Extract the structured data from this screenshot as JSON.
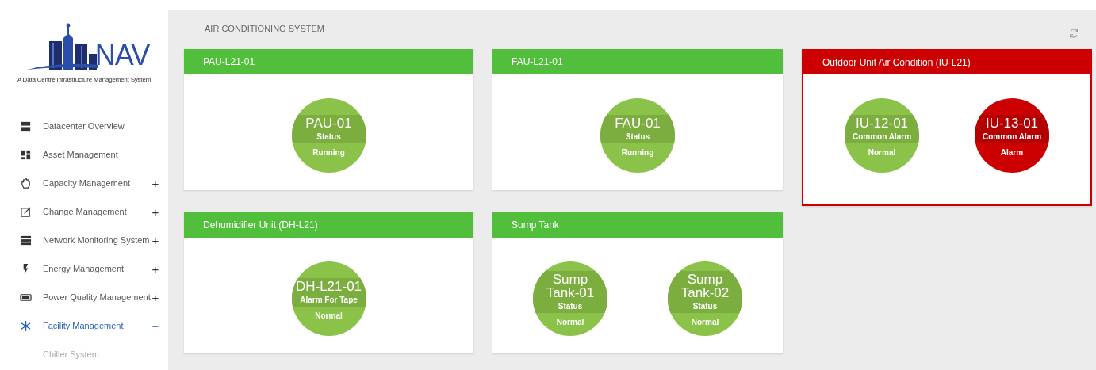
{
  "logo": {
    "wordmark": "NAV",
    "tagline": "A Data Centre Infrastructure Management System"
  },
  "sidebar": {
    "items": [
      {
        "label": "Datacenter Overview",
        "selected": false
      },
      {
        "label": "Asset Management",
        "selected": false
      },
      {
        "label": "Capacity Management",
        "selected": false,
        "toggle": "+",
        "expanded": false
      },
      {
        "label": "Change Management",
        "selected": false,
        "toggle": "+",
        "expanded": false
      },
      {
        "label": "Network Monitoring System",
        "selected": false,
        "toggle": "+",
        "expanded": false
      },
      {
        "label": "Energy Management",
        "selected": false,
        "toggle": "+",
        "expanded": false
      },
      {
        "label": "Power Quality Management",
        "selected": false,
        "toggle": "+",
        "expanded": false
      },
      {
        "label": "Facility Management",
        "selected": true,
        "toggle": "−",
        "expanded": true,
        "children": [
          {
            "label": "Chiller System"
          }
        ]
      }
    ]
  },
  "page_title": "AIR CONDITIONING SYSTEM",
  "cards": [
    {
      "title": "PAU-L21-01",
      "alarm": false,
      "units": [
        {
          "name": "PAU-01",
          "label": "Status",
          "value": "Running",
          "alarm": false
        }
      ]
    },
    {
      "title": "FAU-L21-01",
      "alarm": false,
      "units": [
        {
          "name": "FAU-01",
          "label": "Status",
          "value": "Running",
          "alarm": false
        }
      ]
    },
    {
      "title": "Outdoor Unit Air Condition (IU-L21)",
      "alarm": true,
      "units": [
        {
          "name": "IU-12-01",
          "label": "Common Alarm",
          "value": "Normal",
          "alarm": false
        },
        {
          "name": "IU-13-01",
          "label": "Common Alarm",
          "value": "Alarm",
          "alarm": true
        }
      ]
    },
    {
      "title": "Dehumidifier Unit (DH-L21)",
      "alarm": false,
      "units": [
        {
          "name": "DH-L21-01",
          "label": "Alarm For Tape",
          "value": "Normal",
          "alarm": false
        }
      ]
    },
    {
      "title": "Sump Tank",
      "alarm": false,
      "units": [
        {
          "name": "Sump Tank-01",
          "label": "Status",
          "value": "Normal",
          "alarm": false
        },
        {
          "name": "Sump Tank-02",
          "label": "Status",
          "value": "Normal",
          "alarm": false
        }
      ]
    }
  ]
}
